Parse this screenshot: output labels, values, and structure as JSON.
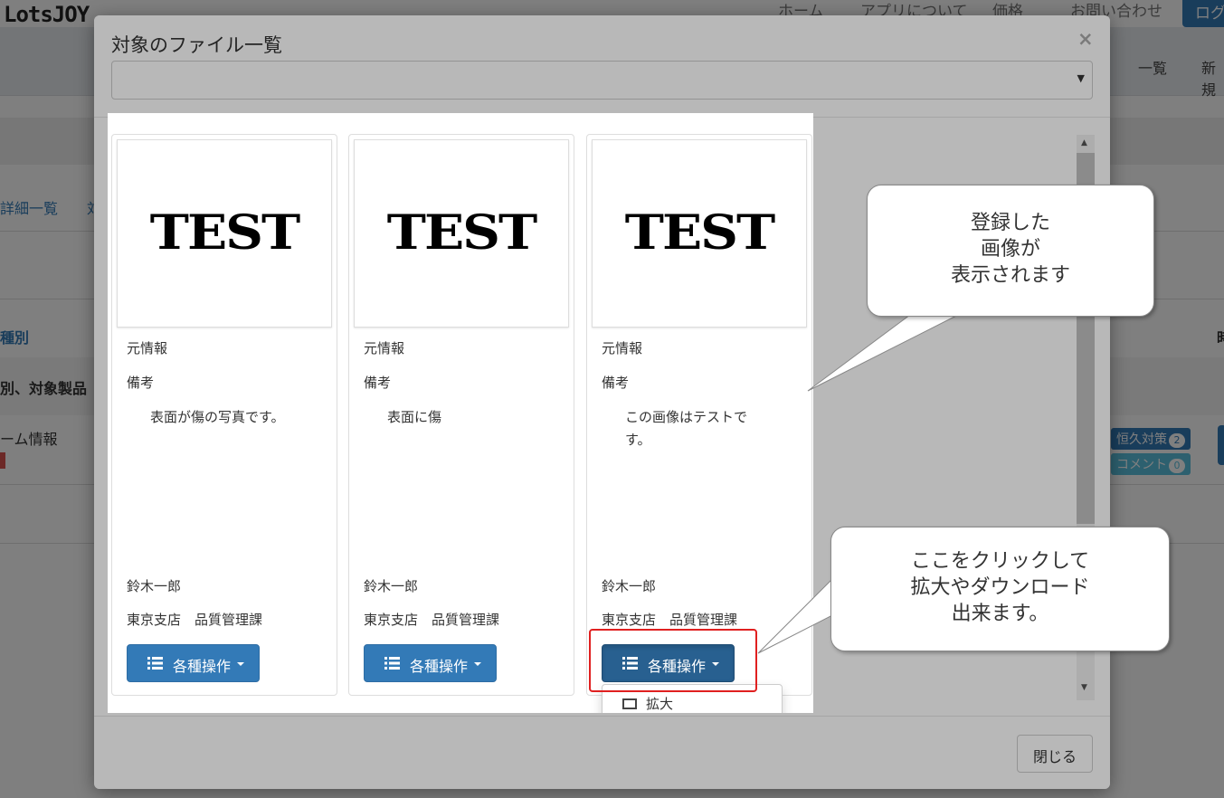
{
  "app": {
    "logo": "LotsJOY",
    "nav": [
      "ホーム",
      "アプリについて",
      "価格",
      "お問い合わせ"
    ],
    "login": "ログ",
    "sub_nav": [
      "一覧",
      "新規"
    ]
  },
  "background": {
    "breadcrumb": "詳細一覧",
    "breadcrumb_trail": "対",
    "col_header": "種別",
    "row_header": "別、対象製品",
    "row_text": "ーム情報",
    "right_header": "時",
    "badge_permanent": "恒久対策",
    "badge_permanent_count": "2",
    "badge_comment": "コメント",
    "badge_comment_count": "0"
  },
  "modal": {
    "title": "対象のファイル一覧",
    "close_glyph": "×",
    "select_value": "",
    "footer_close": "閉じる"
  },
  "cards": [
    {
      "image_text": "TEST",
      "source_label": "元情報",
      "note_label": "備考",
      "note": "表面が傷の写真です。",
      "user": "鈴木一郎",
      "dept": "東京支店　品質管理課",
      "ops_label": "各種操作"
    },
    {
      "image_text": "TEST",
      "source_label": "元情報",
      "note_label": "備考",
      "note": "表面に傷",
      "user": "鈴木一郎",
      "dept": "東京支店　品質管理課",
      "ops_label": "各種操作"
    },
    {
      "image_text": "TEST",
      "source_label": "元情報",
      "note_label": "備考",
      "note": "この画像はテストです。",
      "user": "鈴木一郎",
      "dept": "東京支店　品質管理課",
      "ops_label": "各種操作"
    }
  ],
  "dropdown": {
    "first_item": "拡大"
  },
  "callouts": {
    "image_callout": [
      "登録した",
      "画像が",
      "表示されます"
    ],
    "ops_callout": [
      "ここをクリックして",
      "拡大やダウンロード",
      "出来ます。"
    ]
  },
  "colors": {
    "primary": "#337ab7",
    "primary_active": "#286090",
    "highlight_red": "#e02020",
    "badge_blue": "#5bc0de"
  }
}
